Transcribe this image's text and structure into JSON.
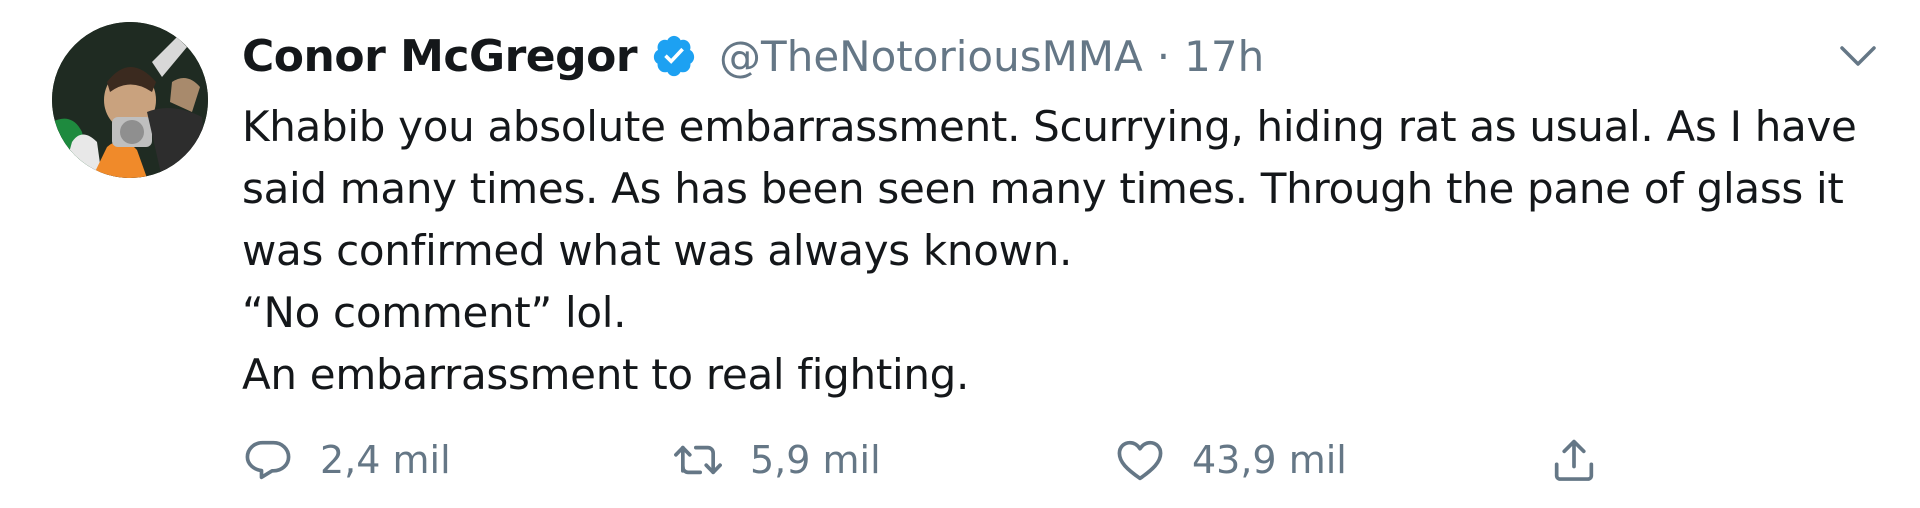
{
  "tweet": {
    "author": {
      "display_name": "Conor McGregor",
      "handle": "@TheNotoriousMMA",
      "verified": true,
      "avatar_icon": "profile-photo"
    },
    "separator": "·",
    "time": "17h",
    "menu_icon": "chevron-down-icon",
    "lines": [
      "Khabib you absolute embarrassment. Scurrying, hiding rat as usual. As I have",
      "said many times. As has been seen many times. Through the pane of glass it",
      "was confirmed what was always known.",
      "“No comment” lol.",
      "An embarrassment to real fighting."
    ],
    "actions": {
      "reply_count": "2,4 mil",
      "retweet_count": "5,9 mil",
      "like_count": "43,9 mil"
    }
  },
  "colors": {
    "text": "#14171a",
    "muted": "#657786",
    "verified_blue": "#1da1f2"
  }
}
